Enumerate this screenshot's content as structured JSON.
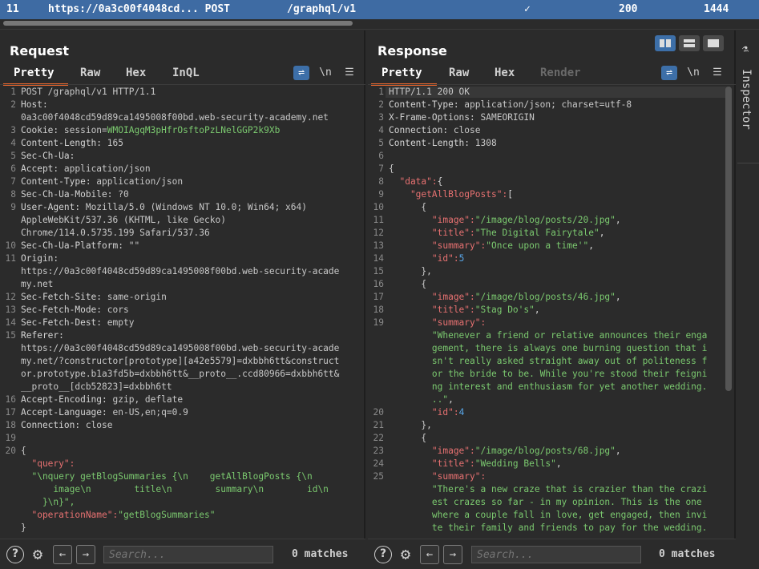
{
  "history_row": {
    "id": "11",
    "url": "https://0a3c00f4048cd... POST",
    "path": "/graphql/v1",
    "check": "✓",
    "status": "200",
    "length": "1444"
  },
  "request": {
    "title": "Request",
    "tabs": [
      "Pretty",
      "Raw",
      "Hex",
      "InQL"
    ],
    "active_tab": "Pretty",
    "lines": [
      {
        "n": "1",
        "k": "",
        "v": "POST /graphql/v1 HTTP/1.1"
      },
      {
        "n": "2",
        "k": "Host:",
        "v": ""
      },
      {
        "n": "",
        "k": "",
        "v": "0a3c00f4048cd59d89ca1495008f00bd.web-security-academy.net"
      },
      {
        "n": "3",
        "k": "Cookie: ",
        "v": "session=",
        "g": "WMOIAgqM3pHfrOsftoPzLNelGGP2k9Xb"
      },
      {
        "n": "4",
        "k": "Content-Length: ",
        "v": "165"
      },
      {
        "n": "5",
        "k": "Sec-Ch-Ua:",
        "v": ""
      },
      {
        "n": "6",
        "k": "Accept: ",
        "v": "application/json"
      },
      {
        "n": "7",
        "k": "Content-Type: ",
        "v": "application/json"
      },
      {
        "n": "8",
        "k": "Sec-Ch-Ua-Mobile: ",
        "v": "?0"
      },
      {
        "n": "9",
        "k": "User-Agent: ",
        "v": "Mozilla/5.0 (Windows NT 10.0; Win64; x64)"
      },
      {
        "n": "",
        "k": "",
        "v": "AppleWebKit/537.36 (KHTML, like Gecko)"
      },
      {
        "n": "",
        "k": "",
        "v": "Chrome/114.0.5735.199 Safari/537.36"
      },
      {
        "n": "10",
        "k": "Sec-Ch-Ua-Platform: ",
        "v": "\"\""
      },
      {
        "n": "11",
        "k": "Origin:",
        "v": ""
      },
      {
        "n": "",
        "k": "",
        "v": "https://0a3c00f4048cd59d89ca1495008f00bd.web-security-acade"
      },
      {
        "n": "",
        "k": "",
        "v": "my.net"
      },
      {
        "n": "12",
        "k": "Sec-Fetch-Site: ",
        "v": "same-origin"
      },
      {
        "n": "13",
        "k": "Sec-Fetch-Mode: ",
        "v": "cors"
      },
      {
        "n": "14",
        "k": "Sec-Fetch-Dest: ",
        "v": "empty"
      },
      {
        "n": "15",
        "k": "Referer:",
        "v": ""
      },
      {
        "n": "",
        "k": "",
        "v": "https://0a3c00f4048cd59d89ca1495008f00bd.web-security-acade"
      },
      {
        "n": "",
        "k": "",
        "v": "my.net/?constructor[prototype][a42e5579]=dxbbh6tt&construct"
      },
      {
        "n": "",
        "k": "",
        "v": "or.prototype.b1a3fd5b=dxbbh6tt&__proto__.ccd80966=dxbbh6tt&"
      },
      {
        "n": "",
        "k": "",
        "v": "__proto__[dcb52823]=dxbbh6tt"
      },
      {
        "n": "16",
        "k": "Accept-Encoding: ",
        "v": "gzip, deflate"
      },
      {
        "n": "17",
        "k": "Accept-Language: ",
        "v": "en-US,en;q=0.9"
      },
      {
        "n": "18",
        "k": "Connection: ",
        "v": "close"
      },
      {
        "n": "19",
        "k": "",
        "v": ""
      },
      {
        "n": "20",
        "k": "",
        "v": "{"
      },
      {
        "n": "",
        "k": "",
        "v": "",
        "r": "  \"query\":"
      },
      {
        "n": "",
        "k": "",
        "v": "",
        "g": "  \"\\nquery getBlogSummaries {\\n    getAllBlogPosts {\\n"
      },
      {
        "n": "",
        "k": "",
        "v": "",
        "g": "      image\\n        title\\n        summary\\n        id\\n"
      },
      {
        "n": "",
        "k": "",
        "v": "",
        "g": "    }\\n}\","
      },
      {
        "n": "",
        "k": "",
        "v": "",
        "r": "  \"operationName\":",
        "g": "\"getBlogSummaries\""
      },
      {
        "n": "",
        "k": "",
        "v": "}"
      }
    ],
    "search_placeholder": "Search...",
    "matches": "0 matches"
  },
  "response": {
    "title": "Response",
    "tabs": [
      "Pretty",
      "Raw",
      "Hex",
      "Render"
    ],
    "active_tab": "Pretty",
    "lines": [
      {
        "n": "1",
        "k": "",
        "v": "HTTP/1.1 200 OK"
      },
      {
        "n": "2",
        "k": "Content-Type: ",
        "v": "application/json; charset=utf-8"
      },
      {
        "n": "3",
        "k": "X-Frame-Options: ",
        "v": "SAMEORIGIN"
      },
      {
        "n": "4",
        "k": "Connection: ",
        "v": "close"
      },
      {
        "n": "5",
        "k": "Content-Length: ",
        "v": "1308"
      },
      {
        "n": "6",
        "k": "",
        "v": ""
      },
      {
        "n": "7",
        "k": "",
        "v": "{"
      },
      {
        "n": "8",
        "k": "",
        "v": "",
        "r": "  \"data\":",
        "p": "{"
      },
      {
        "n": "9",
        "k": "",
        "v": "",
        "r": "    \"getAllBlogPosts\":",
        "p": "["
      },
      {
        "n": "10",
        "k": "",
        "v": "      {"
      },
      {
        "n": "11",
        "k": "",
        "v": "",
        "r": "        \"image\":",
        "g": "\"/image/blog/posts/20.jpg\"",
        "p": ","
      },
      {
        "n": "12",
        "k": "",
        "v": "",
        "r": "        \"title\":",
        "g": "\"The Digital Fairytale\"",
        "p": ","
      },
      {
        "n": "13",
        "k": "",
        "v": "",
        "r": "        \"summary\":",
        "g": "\"Once upon a time'\"",
        "p": ","
      },
      {
        "n": "14",
        "k": "",
        "v": "",
        "r": "        \"id\":",
        "b": "5"
      },
      {
        "n": "15",
        "k": "",
        "v": "      },"
      },
      {
        "n": "16",
        "k": "",
        "v": "      {"
      },
      {
        "n": "17",
        "k": "",
        "v": "",
        "r": "        \"image\":",
        "g": "\"/image/blog/posts/46.jpg\"",
        "p": ","
      },
      {
        "n": "18",
        "k": "",
        "v": "",
        "r": "        \"title\":",
        "g": "\"Stag Do's\"",
        "p": ","
      },
      {
        "n": "19",
        "k": "",
        "v": "",
        "r": "        \"summary\":"
      },
      {
        "n": "",
        "k": "",
        "v": "",
        "g": "        \"Whenever a friend or relative announces their enga"
      },
      {
        "n": "",
        "k": "",
        "v": "",
        "g": "        gement, there is always one burning question that i"
      },
      {
        "n": "",
        "k": "",
        "v": "",
        "g": "        sn't really asked straight away out of politeness f"
      },
      {
        "n": "",
        "k": "",
        "v": "",
        "g": "        or the bride to be. While you're stood their feigni"
      },
      {
        "n": "",
        "k": "",
        "v": "",
        "g": "        ng interest and enthusiasm for yet another wedding."
      },
      {
        "n": "",
        "k": "",
        "v": "",
        "g": "        ..\"",
        "p": ","
      },
      {
        "n": "20",
        "k": "",
        "v": "",
        "r": "        \"id\":",
        "b": "4"
      },
      {
        "n": "21",
        "k": "",
        "v": "      },"
      },
      {
        "n": "22",
        "k": "",
        "v": "      {"
      },
      {
        "n": "23",
        "k": "",
        "v": "",
        "r": "        \"image\":",
        "g": "\"/image/blog/posts/68.jpg\"",
        "p": ","
      },
      {
        "n": "24",
        "k": "",
        "v": "",
        "r": "        \"title\":",
        "g": "\"Wedding Bells\"",
        "p": ","
      },
      {
        "n": "25",
        "k": "",
        "v": "",
        "r": "        \"summary\":"
      },
      {
        "n": "",
        "k": "",
        "v": "",
        "g": "        \"There's a new craze that is crazier than the crazi"
      },
      {
        "n": "",
        "k": "",
        "v": "",
        "g": "        est crazes so far - in my opinion. This is the one"
      },
      {
        "n": "",
        "k": "",
        "v": "",
        "g": "        where a couple fall in love, get engaged, then invi"
      },
      {
        "n": "",
        "k": "",
        "v": "",
        "g": "        te their family and friends to pay for the wedding."
      }
    ],
    "search_placeholder": "Search...",
    "matches": "0 matches"
  },
  "inspector": {
    "label": "Inspector"
  },
  "icons": {
    "wrap": "word-wrap-icon",
    "newline": "\\n",
    "menu": "hamburger-menu-icon",
    "help": "?",
    "settings": "gear-icon",
    "prev": "arrow-left-icon",
    "next": "arrow-right-icon"
  },
  "colors": {
    "accent": "#e8662e",
    "selection": "#3e6ba3",
    "header_key": "#d4d4d4",
    "json_key": "#e77171",
    "json_string": "#7bc96f",
    "json_number": "#58a6e8"
  }
}
